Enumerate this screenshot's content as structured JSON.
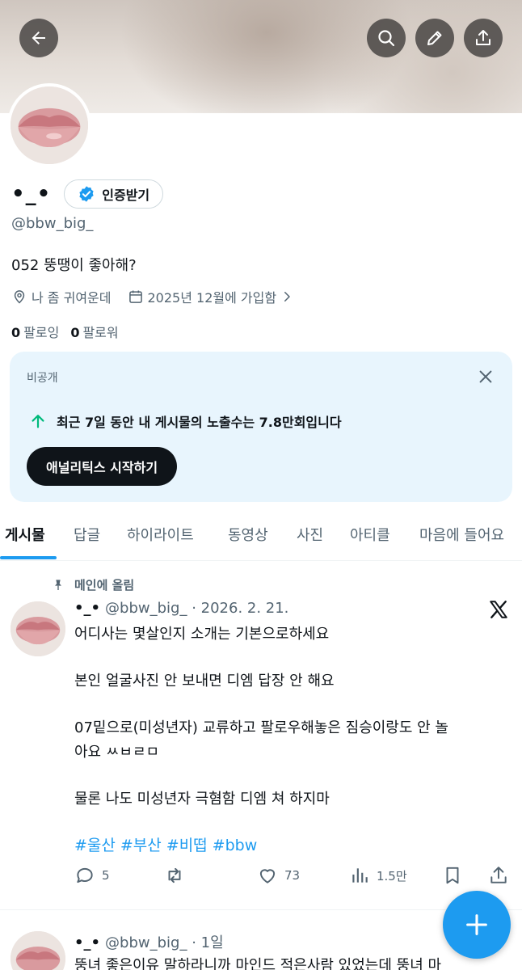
{
  "header": {
    "back_icon": "arrow-left-icon",
    "search_icon": "search-icon",
    "edit_icon": "pencil-icon",
    "share_icon": "share-icon"
  },
  "profile": {
    "display_name": "•_•",
    "verify_label": "인증받기",
    "handle": "@bbw_big_",
    "bio": "052 뚱땡이 좋아해?",
    "location": "나 좀 귀여운데",
    "joined": "2025년 12월에 가입함",
    "following_count": "0",
    "following_label": "팔로잉",
    "followers_count": "0",
    "followers_label": "팔로워"
  },
  "analytics_card": {
    "private_label": "비공개",
    "impressions_text": "최근 7일 동안 내 게시물의 노출수는 7.8만회입니다",
    "cta_label": "애널리틱스 시작하기"
  },
  "tabs": [
    {
      "label": "게시물"
    },
    {
      "label": "답글"
    },
    {
      "label": "하이라이트"
    },
    {
      "label": "동영상"
    },
    {
      "label": "사진"
    },
    {
      "label": "아티클"
    },
    {
      "label": "마음에 들어요"
    }
  ],
  "pinned_post": {
    "pinned_label": "메인에 올림",
    "author_name": "•_•",
    "author_handle": "@bbw_big_",
    "date": "· 2026. 2. 21.",
    "lines": [
      "어디사는 몇살인지 소개는 기본으로하세요",
      "본인 얼굴사진 안 보내면 디엠 답장 안 해요",
      "07밑으로(미성년자) 교류하고 팔로우해놓은 짐승이랑도 안 놀",
      "아요 ㅆㅂㄹㅁ",
      "물론 나도 미성년자 극혐함 디엠 쳐 하지마"
    ],
    "hashtags": [
      "#울산",
      "#부산",
      "#비떱",
      "#bbw"
    ],
    "replies": "5",
    "likes": "73",
    "views": "1.5만"
  },
  "second_post": {
    "author_name": "•_•",
    "author_handle": "@bbw_big_",
    "date": "· 1일",
    "line": "뚱녀 좋은이유 말하라니까 마인드 적은사람 있었는데 뚱녀 마"
  },
  "colors": {
    "accent": "#1d9bf0",
    "text_primary": "#0f1419",
    "text_secondary": "#536471",
    "card_bg": "#e8f5fd",
    "impression_arrow": "#00ba7c"
  }
}
